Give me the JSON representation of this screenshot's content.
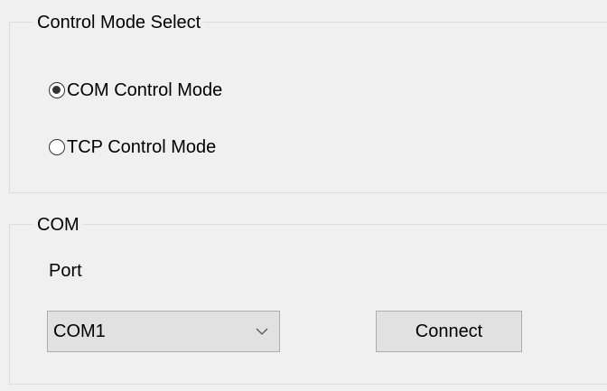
{
  "mode_group": {
    "title": "Control Mode Select",
    "options": [
      {
        "label": "COM Control Mode",
        "checked": true
      },
      {
        "label": "TCP Control Mode",
        "checked": false
      }
    ]
  },
  "com_group": {
    "title": "COM",
    "port_label": "Port",
    "port_select": {
      "value": "COM1",
      "arrow_icon": "chevron-down-icon"
    },
    "connect_label": "Connect"
  },
  "colors": {
    "window_bg": "#f0f0f0",
    "control_bg": "#e1e1e1",
    "control_border": "#adadad",
    "group_border": "#dcdcdc"
  }
}
